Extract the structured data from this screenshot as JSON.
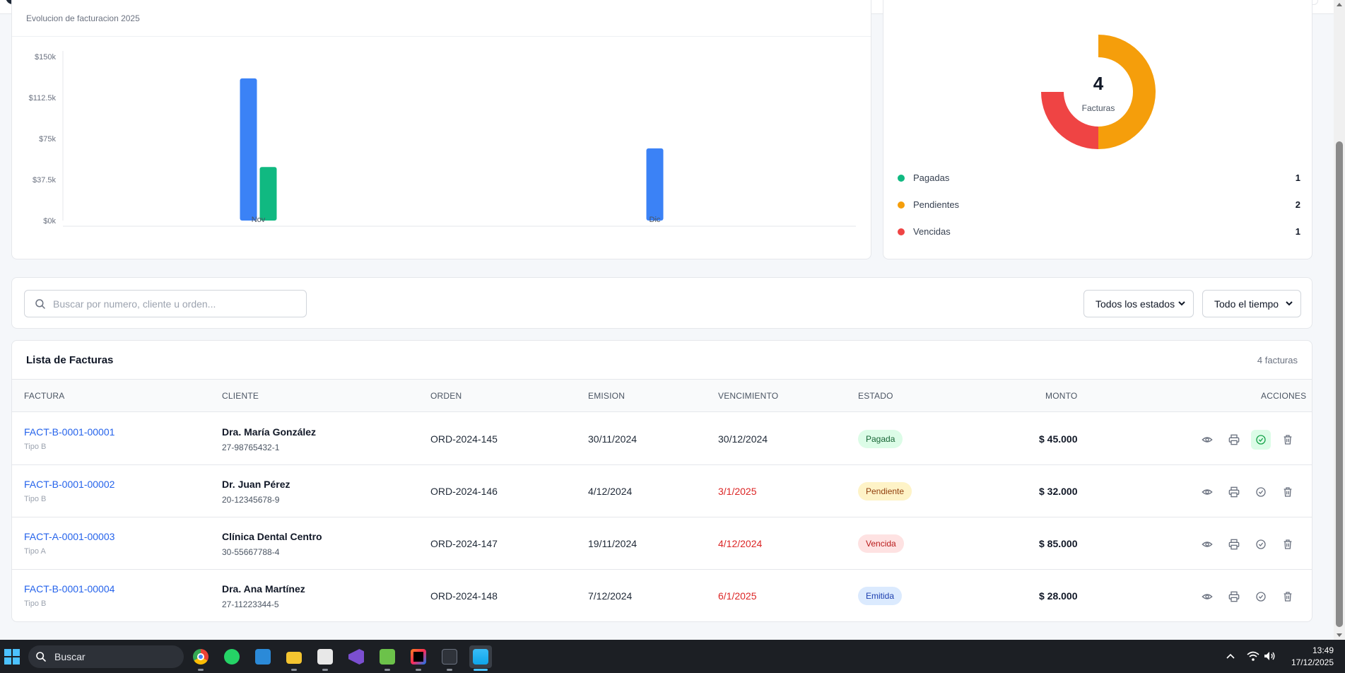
{
  "chart": {
    "subtitle": "Evolucion de facturacion 2025"
  },
  "chart_data": {
    "type": "bar",
    "title": "",
    "categories": [
      "Nov",
      "Dic"
    ],
    "series": [
      {
        "values": [
          130000,
          66000
        ],
        "color": "#3b82f6"
      },
      {
        "values": [
          49000,
          0
        ],
        "color": "#10b981"
      }
    ],
    "ylim": [
      0,
      150000
    ],
    "yticks": [
      "$0k",
      "$37.5k",
      "$75k",
      "$112.5k",
      "$150k"
    ],
    "xlabel": "",
    "ylabel": "",
    "grid": false
  },
  "donut": {
    "total": "4",
    "label": "Facturas",
    "segments": [
      {
        "name": "Pagadas",
        "count": "1",
        "value": 1,
        "color": "#10b981"
      },
      {
        "name": "Pendientes",
        "count": "2",
        "value": 2,
        "color": "#f59e0b"
      },
      {
        "name": "Vencidas",
        "count": "1",
        "value": 1,
        "color": "#ef4444"
      }
    ]
  },
  "filters": {
    "search_placeholder": "Buscar por numero, cliente u orden...",
    "status_select": "Todos los estados",
    "time_select": "Todo el tiempo"
  },
  "table": {
    "title": "Lista de Facturas",
    "count": "4 facturas",
    "columns": {
      "factura": "FACTURA",
      "cliente": "CLIENTE",
      "orden": "ORDEN",
      "emision": "EMISION",
      "vencimiento": "VENCIMIENTO",
      "estado": "ESTADO",
      "monto": "MONTO",
      "acciones": "ACCIONES"
    },
    "rows": [
      {
        "numero": "FACT-B-0001-00001",
        "tipo": "Tipo B",
        "cliente": "Dra. María González",
        "cuit": "27-98765432-1",
        "orden": "ORD-2024-145",
        "emision": "30/11/2024",
        "vencimiento": "30/12/2024",
        "estado": "Pagada",
        "monto": "$ 45.000"
      },
      {
        "numero": "FACT-B-0001-00002",
        "tipo": "Tipo B",
        "cliente": "Dr. Juan Pérez",
        "cuit": "20-12345678-9",
        "orden": "ORD-2024-146",
        "emision": "4/12/2024",
        "vencimiento": "3/1/2025",
        "estado": "Pendiente",
        "monto": "$ 32.000"
      },
      {
        "numero": "FACT-A-0001-00003",
        "tipo": "Tipo A",
        "cliente": "Clínica Dental Centro",
        "cuit": "30-55667788-4",
        "orden": "ORD-2024-147",
        "emision": "19/11/2024",
        "vencimiento": "4/12/2024",
        "estado": "Vencida",
        "monto": "$ 85.000"
      },
      {
        "numero": "FACT-B-0001-00004",
        "tipo": "Tipo B",
        "cliente": "Dra. Ana Martínez",
        "cuit": "27-11223344-5",
        "orden": "ORD-2024-148",
        "emision": "7/12/2024",
        "vencimiento": "6/1/2025",
        "estado": "Emitida",
        "monto": "$ 28.000"
      }
    ]
  },
  "taskbar": {
    "search_label": "Buscar",
    "time": "13:49",
    "date": "17/12/2025"
  }
}
